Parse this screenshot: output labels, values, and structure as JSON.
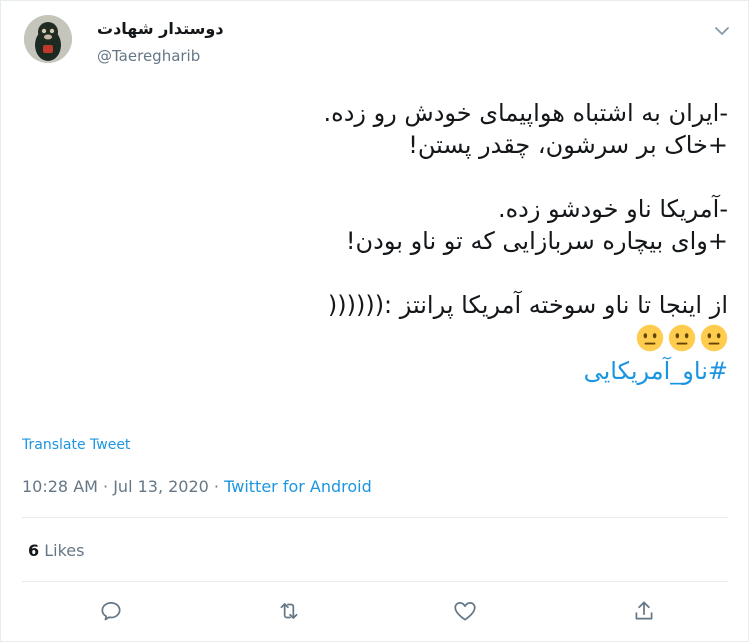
{
  "user": {
    "display_name": "دوستدار شهادت",
    "handle": "@Taereghari​b"
  },
  "tweet": {
    "lines": [
      "-ایران به اشتباه هواپیمای خودش رو زده.",
      "+خاک بر سرشون، چقدر پستن!",
      "-آمریکا ناو خودشو زده.",
      "+وای بیچاره سربازایی که تو ناو بودن!",
      "از اینجا تا ناو سوخته آمریکا پرانتز :(((((("
    ],
    "emoji_icons": [
      "neutral-face-icon",
      "neutral-face-icon",
      "neutral-face-icon"
    ],
    "hashtag": "#ناو_آمریکایی"
  },
  "translate_label": "Translate Tweet",
  "meta": {
    "time": "10:28 AM · Jul 13, 2020",
    "separator": " · ",
    "source": "Twitter for Android"
  },
  "stats": {
    "likes_count": "6",
    "likes_label": "Likes"
  },
  "actions": [
    "reply-icon",
    "retweet-icon",
    "like-icon",
    "share-icon"
  ],
  "colors": {
    "link": "#1b95e0",
    "secondary_text": "#657786",
    "border": "#e6ecf0",
    "emoji": "#ffcc4d"
  }
}
